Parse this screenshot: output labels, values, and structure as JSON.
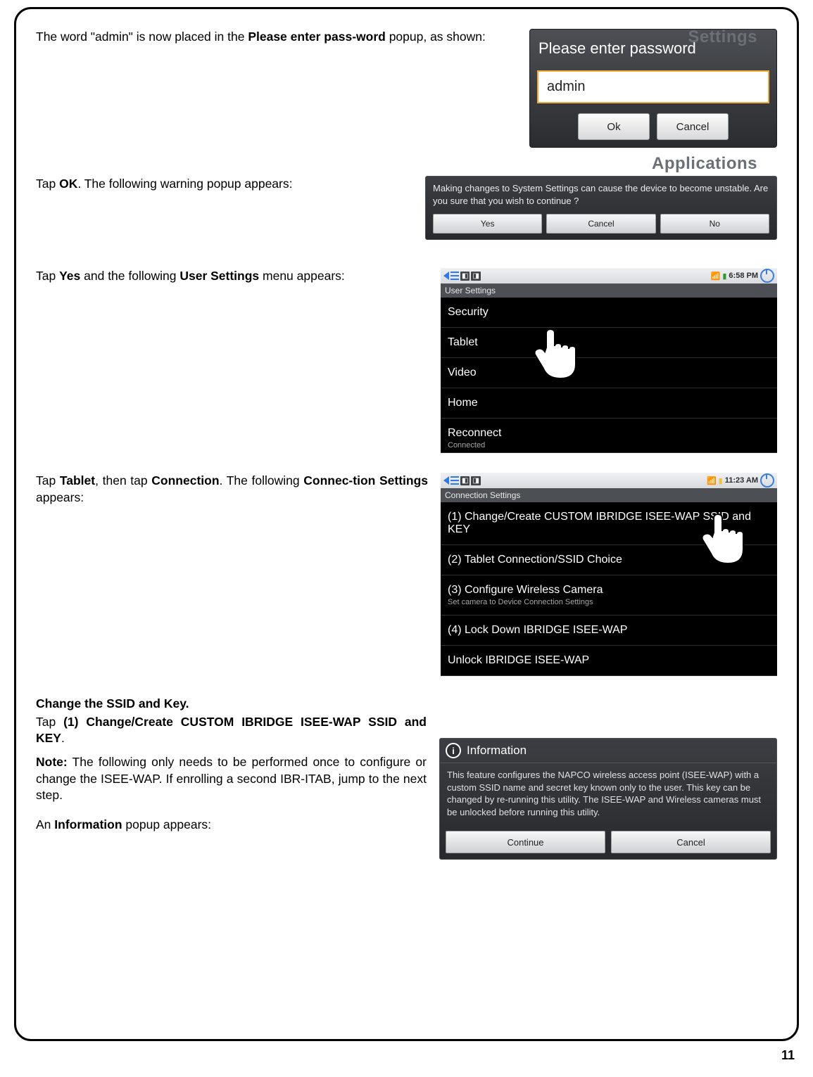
{
  "page_number": "11",
  "section1": {
    "text_parts": [
      "The word \"admin\" is now placed in the ",
      "Please enter pass-word",
      " popup, as shown:"
    ],
    "popup": {
      "bg_text_top": "Settings",
      "bg_text_bottom": "Applications",
      "title": "Please enter password",
      "input_value": "admin",
      "ok": "Ok",
      "cancel": "Cancel"
    }
  },
  "section2": {
    "text_parts": [
      "Tap ",
      "OK",
      ".  The following warning popup appears:"
    ],
    "popup": {
      "message": "Making changes to System Settings can cause the device to become unstable.  Are you sure that you wish to continue ?",
      "yes": "Yes",
      "cancel": "Cancel",
      "no": "No"
    }
  },
  "section3": {
    "text_parts": [
      "Tap ",
      "Yes",
      " and the following ",
      "User Settings",
      " menu appears:"
    ],
    "screen": {
      "status_time": "6:58 PM",
      "heading": "User Settings",
      "items": [
        {
          "label": "Security"
        },
        {
          "label": "Tablet"
        },
        {
          "label": "Video"
        },
        {
          "label": "Home"
        },
        {
          "label": "Reconnect",
          "sub": "Connected"
        }
      ]
    }
  },
  "section4": {
    "text_parts": [
      "Tap ",
      "Tablet",
      ", then tap ",
      "Connection",
      ".  The following ",
      "Connec-tion Settings",
      " appears:"
    ],
    "screen": {
      "status_time": "11:23 AM",
      "heading": "Connection Settings",
      "items": [
        {
          "label": "(1) Change/Create CUSTOM IBRIDGE ISEE-WAP SSID and KEY"
        },
        {
          "label": "(2) Tablet Connection/SSID Choice"
        },
        {
          "label": "(3) Configure Wireless Camera",
          "sub": "Set camera to Device Connection Settings"
        },
        {
          "label": "(4) Lock Down IBRIDGE ISEE-WAP"
        },
        {
          "label": "Unlock IBRIDGE ISEE-WAP"
        }
      ]
    }
  },
  "section5": {
    "heading": "Change the SSID and Key.",
    "line2_parts": [
      "Tap ",
      "(1) Change/Create CUSTOM IBRIDGE ISEE-WAP SSID and KEY",
      "."
    ],
    "note_parts": [
      "Note:",
      "  The following only needs to be performed once to configure or change the ISEE-WAP.  If enrolling a second IBR-ITAB, jump to the next step."
    ],
    "line3_parts": [
      "An ",
      "Information",
      " popup appears:"
    ],
    "popup": {
      "title": "Information",
      "body": "This feature configures the NAPCO wireless access point (ISEE-WAP) with a custom SSID name and secret key known only to the user. This key can be changed by re-running this utility. The ISEE-WAP and Wireless cameras must be unlocked before running this utility.",
      "continue": "Continue",
      "cancel": "Cancel"
    }
  }
}
